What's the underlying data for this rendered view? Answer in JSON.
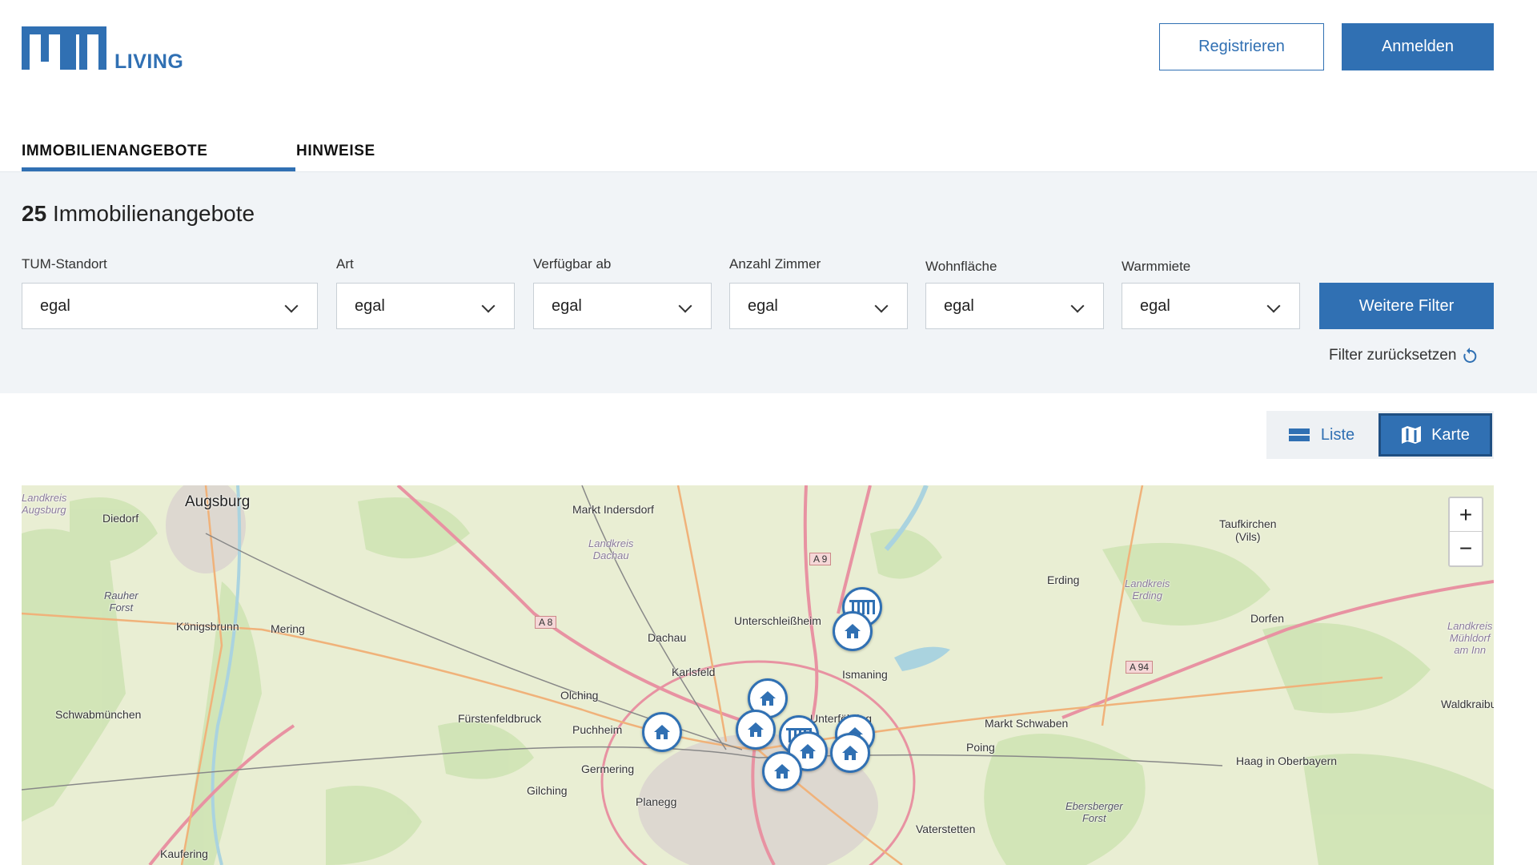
{
  "header": {
    "logo_text": "TUM",
    "logo_sub": "LIVING",
    "register_label": "Registrieren",
    "login_label": "Anmelden"
  },
  "tabs": [
    {
      "label": "IMMOBILIENANGEBOTE",
      "active": true
    },
    {
      "label": "HINWEISE",
      "active": false
    }
  ],
  "filters": {
    "count": "25",
    "count_label": "Immobilienangebote",
    "fields": [
      {
        "label": "TUM-Standort",
        "value": "egal"
      },
      {
        "label": "Art",
        "value": "egal"
      },
      {
        "label": "Verfügbar ab",
        "value": "egal"
      },
      {
        "label": "Anzahl Zimmer",
        "value": "egal"
      },
      {
        "label": "Wohnfläche",
        "value": "egal"
      },
      {
        "label": "Warmmiete",
        "value": "egal"
      }
    ],
    "more_label": "Weitere Filter",
    "reset_label": "Filter zurücksetzen"
  },
  "view": {
    "list_label": "Liste",
    "map_label": "Karte",
    "selected": "Karte"
  },
  "map": {
    "zoom_in": "+",
    "zoom_out": "−",
    "places": [
      {
        "name": "Augsburg",
        "kind": "big"
      },
      {
        "name": "Diedorf",
        "kind": "town"
      },
      {
        "name": "Markt Indersdorf",
        "kind": "town"
      },
      {
        "name": "Landkreis\nDachau",
        "kind": "dist"
      },
      {
        "name": "Landkreis\nAugsburg",
        "kind": "dist"
      },
      {
        "name": "Rauher\nForst",
        "kind": "forest"
      },
      {
        "name": "Königsbrunn",
        "kind": "town"
      },
      {
        "name": "Mering",
        "kind": "town"
      },
      {
        "name": "Dachau",
        "kind": "town"
      },
      {
        "name": "Unterschleißheim",
        "kind": "town"
      },
      {
        "name": "Karlsfeld",
        "kind": "town"
      },
      {
        "name": "Olching",
        "kind": "town"
      },
      {
        "name": "Fürstenfeldbruck",
        "kind": "town"
      },
      {
        "name": "Puchheim",
        "kind": "town"
      },
      {
        "name": "Schwabmünchen",
        "kind": "town"
      },
      {
        "name": "Germering",
        "kind": "town"
      },
      {
        "name": "Gilching",
        "kind": "town"
      },
      {
        "name": "Planegg",
        "kind": "town"
      },
      {
        "name": "Kaufering",
        "kind": "town"
      },
      {
        "name": "Ismaning",
        "kind": "town"
      },
      {
        "name": "Unterföhring",
        "kind": "town"
      },
      {
        "name": "Erding",
        "kind": "town"
      },
      {
        "name": "Landkreis\nErding",
        "kind": "dist"
      },
      {
        "name": "Taufkirchen\n(Vils)",
        "kind": "town"
      },
      {
        "name": "Dorfen",
        "kind": "town"
      },
      {
        "name": "Markt Schwaben",
        "kind": "town"
      },
      {
        "name": "Poing",
        "kind": "town"
      },
      {
        "name": "Haag in Oberbayern",
        "kind": "town"
      },
      {
        "name": "Waldkraiburg",
        "kind": "town"
      },
      {
        "name": "Ebersberger\nForst",
        "kind": "forest"
      },
      {
        "name": "Vaterstetten",
        "kind": "town"
      },
      {
        "name": "Landkreis\nMühldorf\nam Inn",
        "kind": "dist"
      }
    ],
    "roads": [
      "A 9",
      "A 8",
      "A 94"
    ]
  }
}
